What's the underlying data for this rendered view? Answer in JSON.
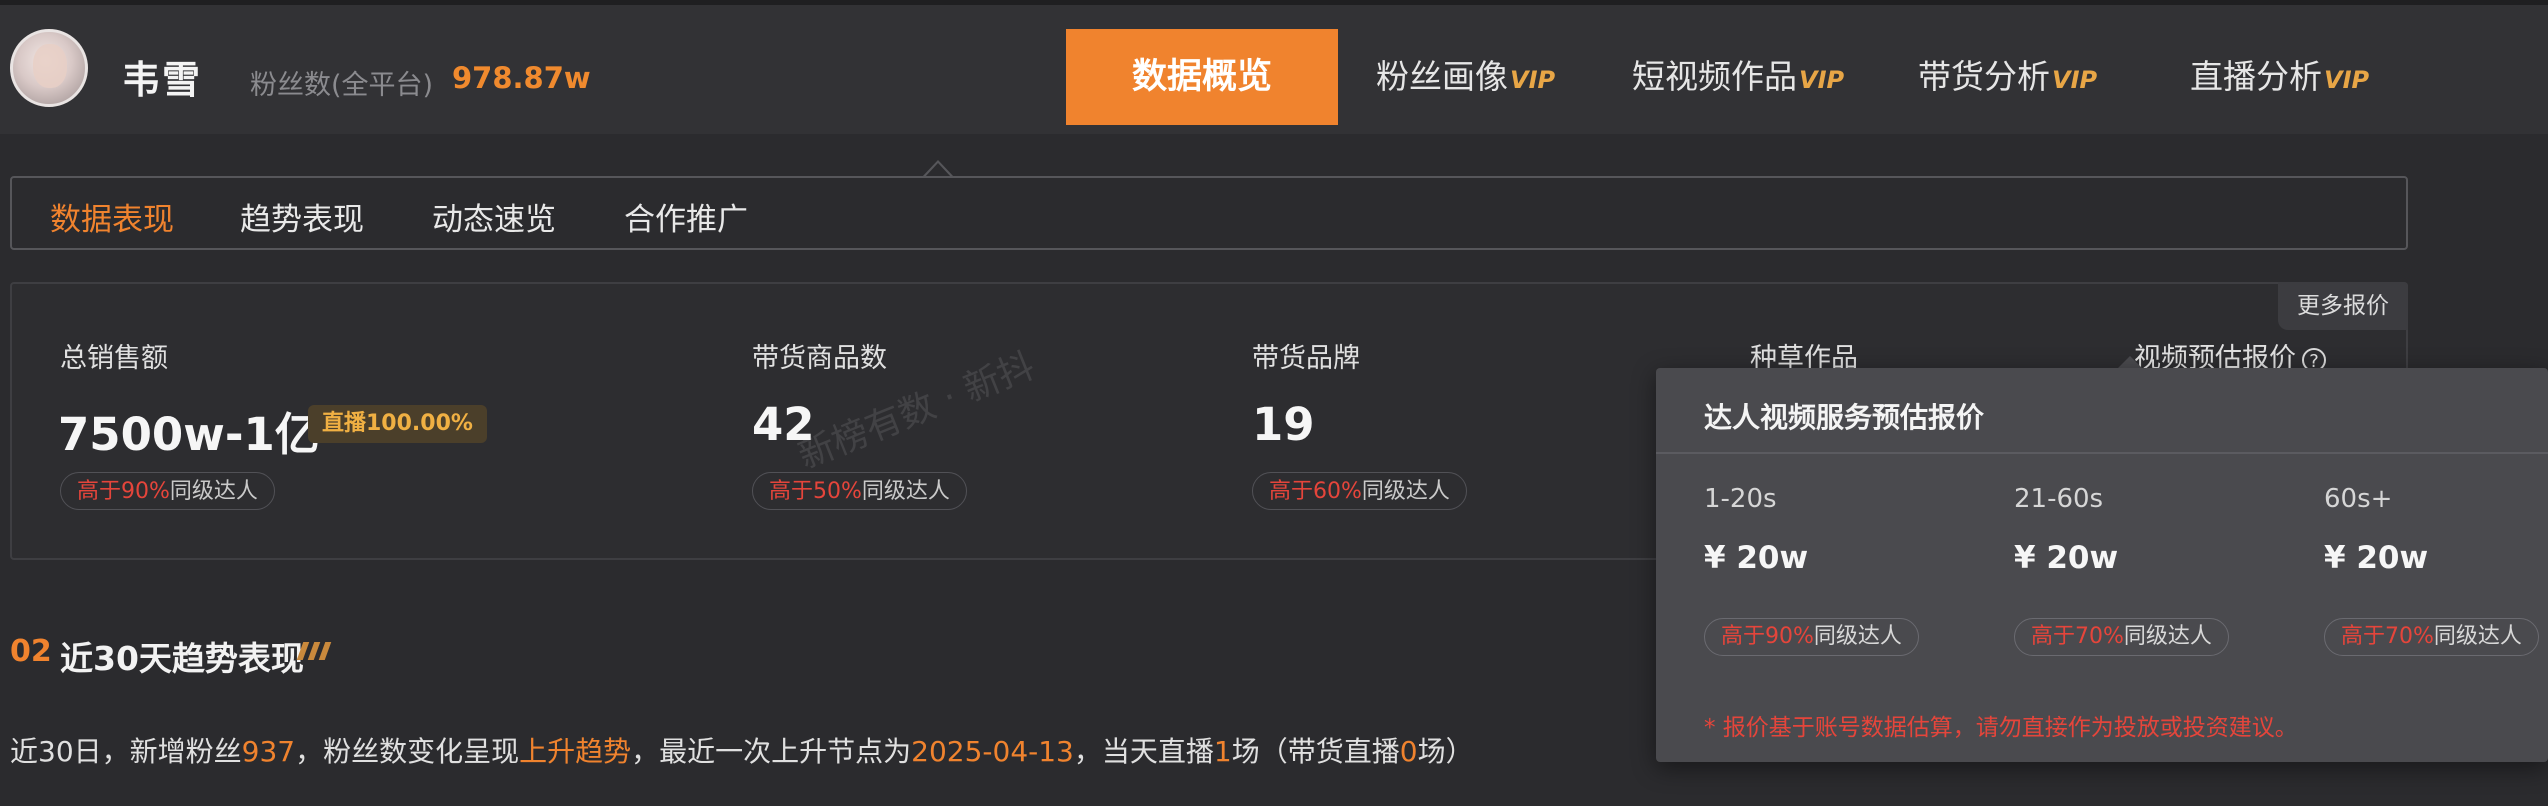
{
  "profile": {
    "name": "韦雪",
    "fans_label": "粉丝数(全平台)",
    "fans_value": "978.87w"
  },
  "nav": {
    "tabs": [
      {
        "label": "数据概览",
        "vip": ""
      },
      {
        "label": "粉丝画像",
        "vip": "VIP"
      },
      {
        "label": "短视频作品",
        "vip": "VIP"
      },
      {
        "label": "带货分析",
        "vip": "VIP"
      },
      {
        "label": "直播分析",
        "vip": "VIP"
      }
    ]
  },
  "subnav": {
    "tabs": [
      "数据表现",
      "趋势表现",
      "动态速览",
      "合作推广"
    ]
  },
  "stats": {
    "more_price": "更多报价",
    "items": [
      {
        "label": "总销售额",
        "value": "7500w-1亿",
        "badge": "直播100.00%",
        "pill_hi": "高于90%",
        "pill_rest": "同级达人"
      },
      {
        "label": "带货商品数",
        "value": "42",
        "pill_hi": "高于50%",
        "pill_rest": "同级达人"
      },
      {
        "label": "带货品牌",
        "value": "19",
        "pill_hi": "高于60%",
        "pill_rest": "同级达人"
      },
      {
        "label": "种草作品"
      },
      {
        "label": "视频预估报价",
        "help": "?"
      }
    ],
    "watermark": "新榜有数 · 新抖"
  },
  "section": {
    "number": "02",
    "title": "近30天趋势表现",
    "summary": {
      "p1": "近30日，新增粉丝",
      "fans": "937",
      "p2": "，粉丝数变化呈现",
      "trend": "上升趋势",
      "p3": "，最近一次上升节点为",
      "date": "2025-04-13",
      "p4": "，当天直播",
      "live": "1",
      "p5": "场（带货直播",
      "sales_live": "0",
      "p6": "场）"
    }
  },
  "popup": {
    "title": "达人视频服务预估报价",
    "columns": [
      {
        "duration": "1-20s",
        "price": "¥ 20w",
        "hi": "高于90%",
        "rest": "同级达人"
      },
      {
        "duration": "21-60s",
        "price": "¥ 20w",
        "hi": "高于70%",
        "rest": "同级达人"
      },
      {
        "duration": "60s+",
        "price": "¥ 20w",
        "hi": "高于70%",
        "rest": "同级达人"
      }
    ],
    "note": "* 报价基于账号数据估算，请勿直接作为投放或投资建议。"
  },
  "colors": {
    "accent": "#f0832e",
    "vip": "#e8a646",
    "danger": "#e5453b",
    "background": "#2b2b2e"
  }
}
